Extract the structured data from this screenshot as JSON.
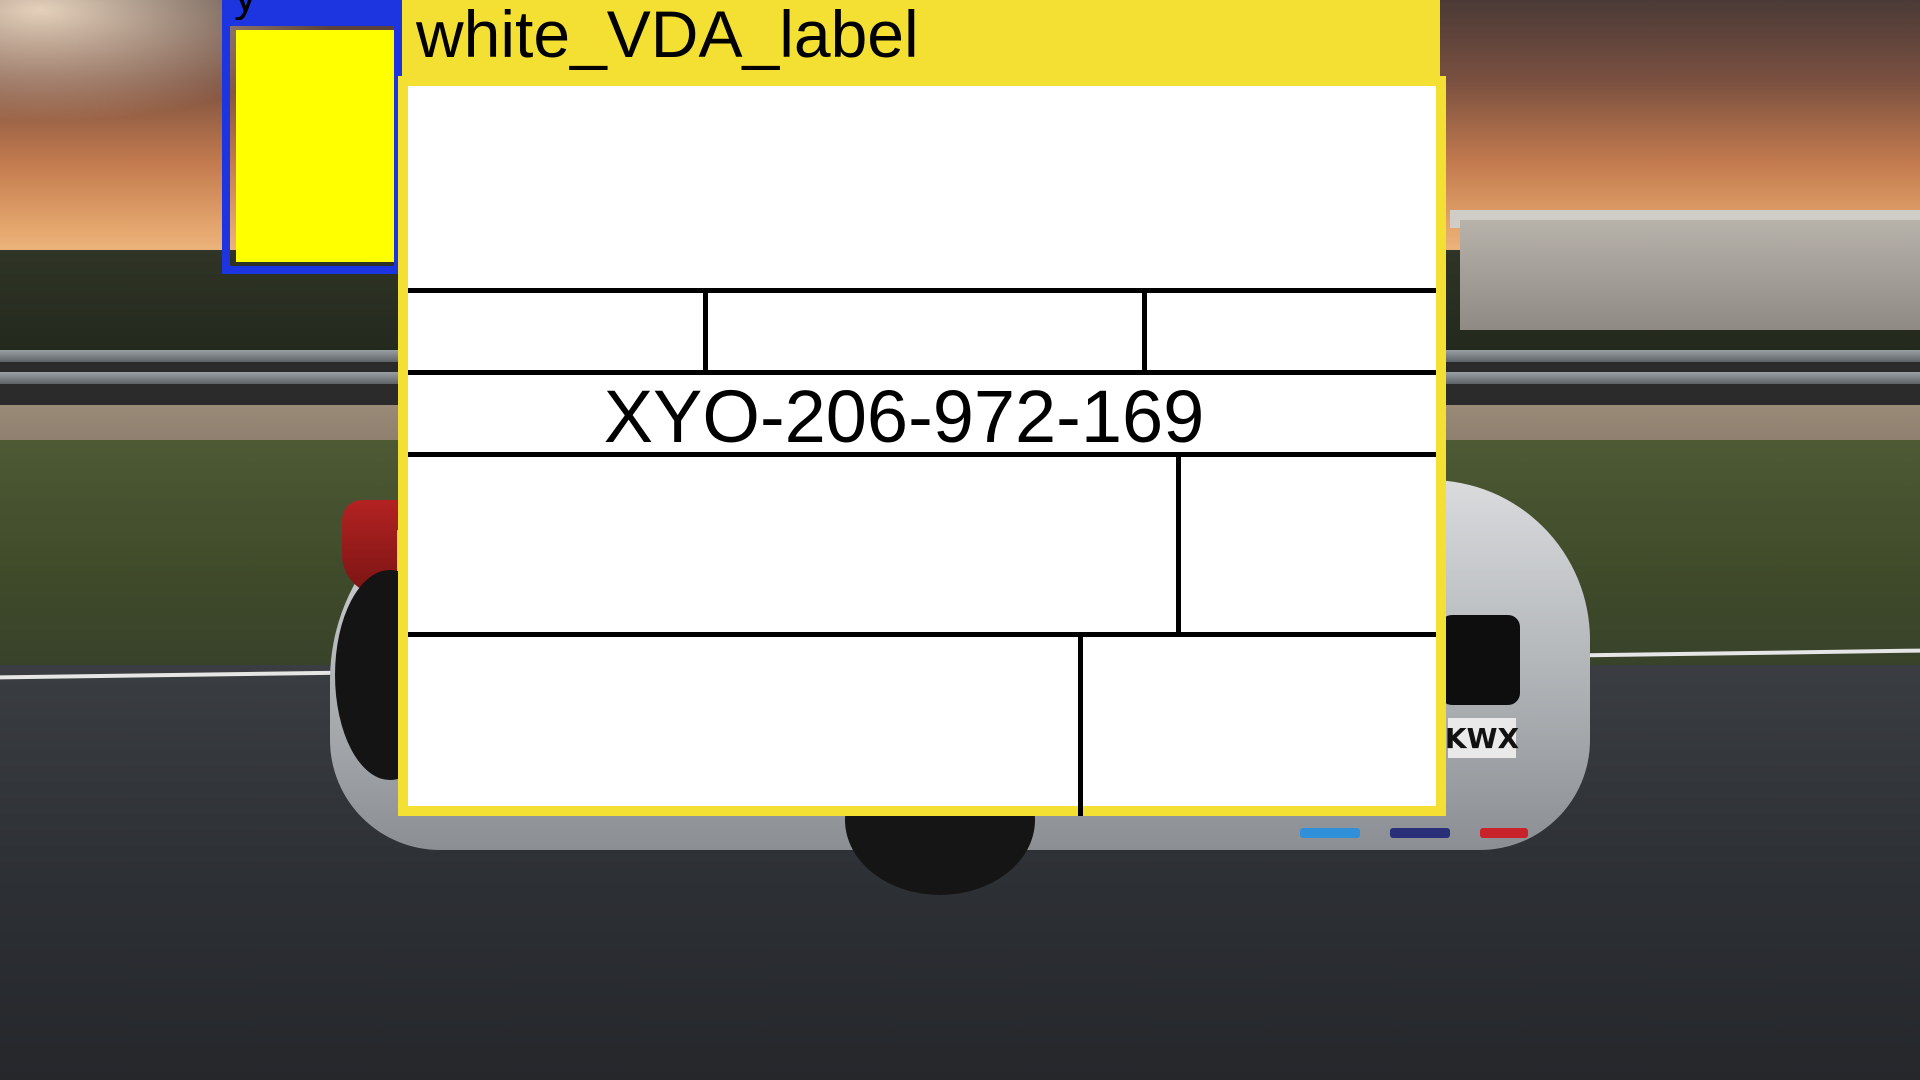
{
  "annotation": {
    "label_class": "white_VDA_label",
    "partial_label": "y",
    "code": "XYO-206-972-169"
  },
  "scene": {
    "license_plate": "KWX"
  },
  "colors": {
    "label_box": "#f4df33",
    "secondary_box": "#1d35e0",
    "yellow_patch": "#ffff00"
  }
}
